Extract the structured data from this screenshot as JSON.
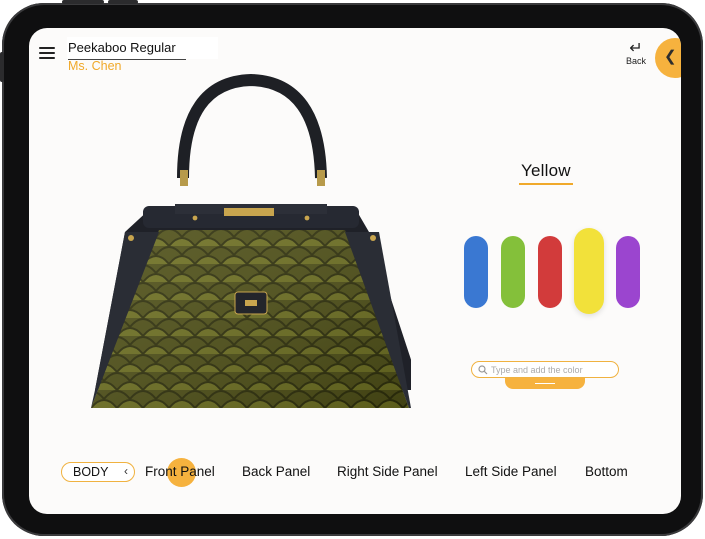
{
  "header": {
    "product_name": "Peekaboo Regular",
    "customer_name": "Ms. Chen",
    "back_label": "Back"
  },
  "colors": {
    "accent": "#f6b23e",
    "selected_name": "Yellow",
    "swatches": [
      {
        "name": "blue",
        "hex": "#3a78d2"
      },
      {
        "name": "green",
        "hex": "#84c03a"
      },
      {
        "name": "red",
        "hex": "#d23b3b"
      },
      {
        "name": "yellow",
        "hex": "#f2e13a",
        "selected": true
      },
      {
        "name": "purple",
        "hex": "#9b45cf"
      }
    ]
  },
  "search": {
    "placeholder": "Type and add the color"
  },
  "parts": {
    "section_label": "BODY",
    "tabs": [
      "Front Panel",
      "Back Panel",
      "Right Side Panel",
      "Left Side Panel",
      "Bottom"
    ],
    "active_tab": "Front Panel"
  },
  "icons": {
    "menu": "hamburger-icon",
    "back": "return-arrow-icon",
    "collapse": "chevron-left-icon",
    "search": "search-icon"
  }
}
